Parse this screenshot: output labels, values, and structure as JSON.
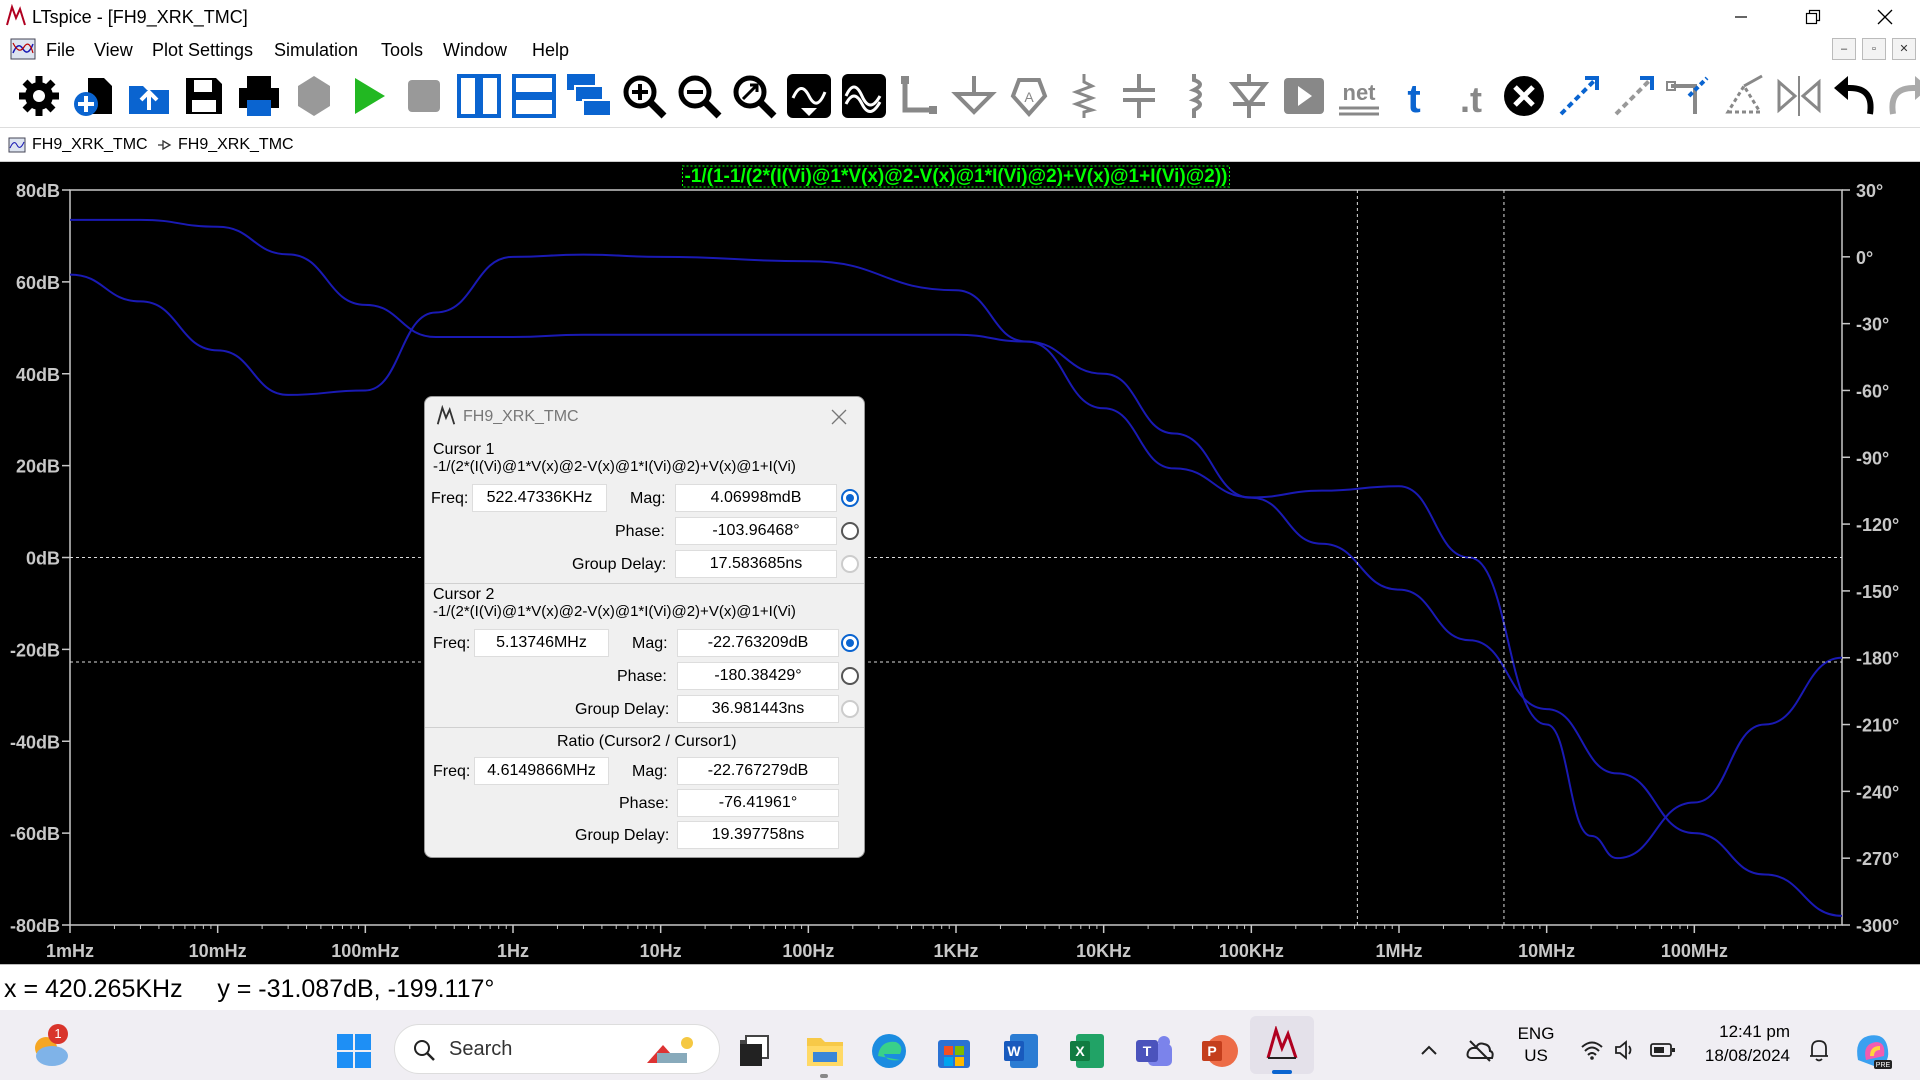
{
  "window": {
    "title": "LTspice - [FH9_XRK_TMC]",
    "controls": [
      "minimize",
      "restore",
      "close"
    ]
  },
  "menu": [
    "File",
    "View",
    "Plot Settings",
    "Simulation",
    "Tools",
    "Window",
    "Help"
  ],
  "mdi_controls": [
    "–",
    "▫",
    "✕"
  ],
  "toolbar": [
    "settings-icon",
    "new-schematic-icon",
    "open-icon",
    "save-icon",
    "print-icon",
    "halt-icon",
    "run-icon",
    "stop-icon",
    "tile-vertical-icon",
    "tile-horizontal-icon",
    "cascade-icon",
    "zoom-in-icon",
    "zoom-out-icon",
    "zoom-fit-icon",
    "autorange-icon",
    "waveform-icon",
    "wire-icon",
    "ground-icon",
    "label-icon",
    "resistor-icon",
    "capacitor-icon",
    "inductor-icon",
    "diode-icon",
    "component-icon",
    "netlist-icon",
    "text-icon",
    "spice-directive-icon",
    "delete-icon",
    "duplicate-icon",
    "move-icon",
    "drag-icon",
    "rotate-icon",
    "mirror-icon",
    "undo-icon",
    "redo-icon"
  ],
  "tabs": [
    {
      "label": "FH9_XRK_TMC",
      "icon": "waveform-tab-icon"
    },
    {
      "label": "FH9_XRK_TMC",
      "icon": "schematic-tab-icon"
    }
  ],
  "plot": {
    "trace_label": "-1/(1-1/(2*(I(Vi)@1*V(x)@2-V(x)@1*I(Vi)@2)+V(x)@1+I(Vi)@2))",
    "colors": {
      "background": "#000000",
      "axis": "#c8c8c8",
      "trace": "#1a1ab4",
      "label": "#00ff00"
    }
  },
  "chart_data": {
    "type": "line",
    "title": "-1/(1-1/(2*(I(Vi)@1*V(x)@2-V(x)@1*I(Vi)@2)+V(x)@1+I(Vi)@2))",
    "x_scale": "log",
    "x_ticks": [
      "1mHz",
      "10mHz",
      "100mHz",
      "1Hz",
      "10Hz",
      "100Hz",
      "1KHz",
      "10KHz",
      "100KHz",
      "1MHz",
      "10MHz",
      "100MHz"
    ],
    "xlim": [
      0.001,
      1000000000
    ],
    "y_left_ticks": [
      "80dB",
      "60dB",
      "40dB",
      "20dB",
      "0dB",
      "-20dB",
      "-40dB",
      "-60dB",
      "-80dB"
    ],
    "ylim_left": [
      -80,
      80
    ],
    "y_right_ticks": [
      "30°",
      "0°",
      "-30°",
      "-60°",
      "-90°",
      "-120°",
      "-150°",
      "-180°",
      "-210°",
      "-240°",
      "-270°",
      "-300°"
    ],
    "ylim_right": [
      -300,
      30
    ],
    "series": [
      {
        "type": "magnitude",
        "unit": "dB",
        "x": [
          0.001,
          0.003,
          0.01,
          0.03,
          0.1,
          0.3,
          1,
          3,
          10,
          100,
          1000,
          3000,
          10000,
          30000,
          100000,
          300000,
          1000000,
          3000000,
          10000000,
          30000000,
          100000000,
          300000000,
          1000000000
        ],
        "values": [
          73.5,
          73.5,
          72,
          66,
          55,
          48,
          48,
          48.5,
          48.5,
          48.5,
          48.5,
          47,
          40,
          27,
          13,
          3,
          -7,
          -18,
          -33,
          -47,
          -60,
          -69,
          -78
        ]
      },
      {
        "type": "phase",
        "unit": "°",
        "x": [
          0.001,
          0.003,
          0.01,
          0.03,
          0.1,
          0.3,
          1,
          3,
          10,
          100,
          1000,
          3000,
          10000,
          30000,
          100000,
          300000,
          1000000,
          3000000,
          10000000,
          20000000,
          30000000,
          100000000,
          300000000,
          1000000000
        ],
        "values": [
          -8,
          -20,
          -42,
          -62,
          -60,
          -25,
          0,
          1,
          0,
          -2,
          -15,
          -38,
          -68,
          -95,
          -108,
          -105,
          -103,
          -135,
          -210,
          -260,
          -270,
          -245,
          -210,
          -180
        ]
      }
    ],
    "cursors": [
      {
        "name": "Cursor 1",
        "freq": "522.47336KHz",
        "x": 522473.36,
        "mag_db": 0.004
      },
      {
        "name": "Cursor 2",
        "freq": "5.13746MHz",
        "x": 5137460,
        "mag_db": -22.76
      }
    ],
    "grid": false
  },
  "dialog": {
    "title": "FH9_XRK_TMC",
    "cursor1": {
      "heading": "Cursor 1",
      "expr": "-1/(2*(I(Vi)@1*V(x)@2-V(x)@1*I(Vi)@2)+V(x)@1+I(Vi)",
      "freq_label": "Freq:",
      "freq": "522.47336KHz",
      "mag_label": "Mag:",
      "mag": "4.06998mdB",
      "phase_label": "Phase:",
      "phase": "-103.96468°",
      "gd_label": "Group Delay:",
      "gd": "17.583685ns"
    },
    "cursor2": {
      "heading": "Cursor 2",
      "expr": "-1/(2*(I(Vi)@1*V(x)@2-V(x)@1*I(Vi)@2)+V(x)@1+I(Vi)",
      "freq_label": "Freq:",
      "freq": "5.13746MHz",
      "mag_label": "Mag:",
      "mag": "-22.763209dB",
      "phase_label": "Phase:",
      "phase": "-180.38429°",
      "gd_label": "Group Delay:",
      "gd": "36.981443ns"
    },
    "ratio": {
      "heading": "Ratio (Cursor2 / Cursor1)",
      "freq_label": "Freq:",
      "freq": "4.6149866MHz",
      "mag_label": "Mag:",
      "mag": "-22.767279dB",
      "phase_label": "Phase:",
      "phase": "-76.41961°",
      "gd_label": "Group Delay:",
      "gd": "19.397758ns"
    }
  },
  "status": {
    "text": "x = 420.265KHz     y = -31.087dB, -199.117°"
  },
  "taskbar": {
    "weather_badge": "1",
    "search_placeholder": "Search",
    "apps": [
      "task-view-icon",
      "file-explorer-icon",
      "edge-icon",
      "store-icon",
      "word-icon",
      "excel-icon",
      "teams-icon",
      "powerpoint-icon",
      "ltspice-icon"
    ],
    "lang1": "ENG",
    "lang2": "US",
    "time": "12:41 pm",
    "date": "18/08/2024"
  }
}
